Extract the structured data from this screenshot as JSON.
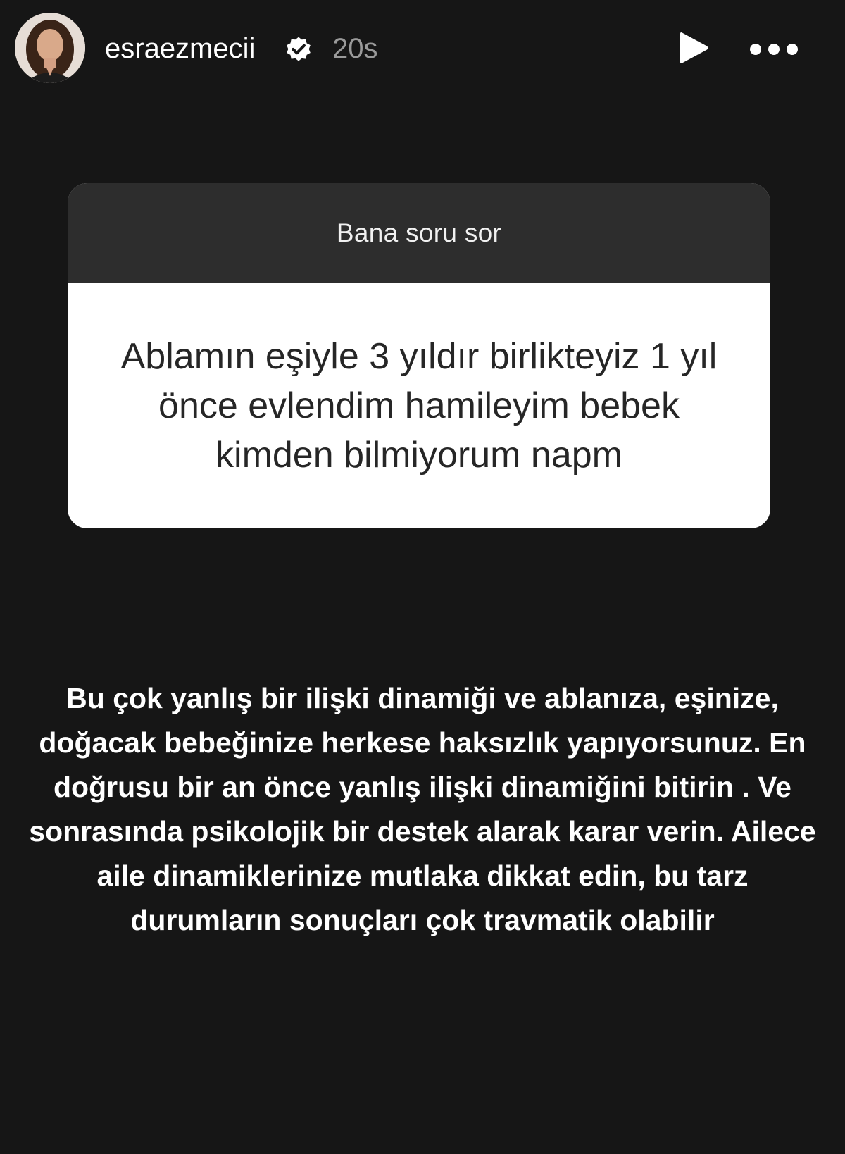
{
  "header": {
    "username": "esraezmecii",
    "timestamp": "20s",
    "icons": {
      "avatar": "profile-photo",
      "verified": "verified-badge-icon",
      "play": "play-icon",
      "more": "more-options-icon"
    }
  },
  "question_card": {
    "title": "Bana soru sor",
    "question": "Ablamın eşiyle 3 yıldır birlikteyiz  1 yıl önce evlendim hamileyim bebek kimden bilmiyorum napm"
  },
  "answer": {
    "text": "Bu çok yanlış bir ilişki dinamiği ve ablanıza, eşinize, doğacak bebeğinize herkese haksızlık yapıyorsunuz. En doğrusu bir an önce yanlış ilişki dinamiğini bitirin . Ve sonrasında psikolojik bir destek alarak karar verin. Ailece aile dinamiklerinize mutlaka dikkat edin, bu tarz durumların sonuçları çok travmatik olabilir"
  },
  "colors": {
    "background": "#161616",
    "card_header": "#2d2d2d",
    "card_body": "#ffffff",
    "timestamp": "#9a9a9a"
  }
}
